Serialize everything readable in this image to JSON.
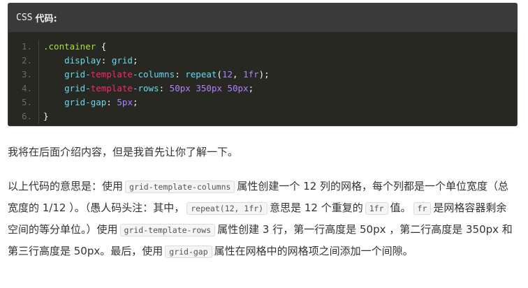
{
  "code_block": {
    "header_lang": "CSS",
    "header_label": "代码:",
    "lines": [
      {
        "num": "1.",
        "selector": ".container",
        "brace": " {"
      },
      {
        "num": "2.",
        "prop": "display",
        "value": "grid"
      },
      {
        "num": "3.",
        "prop_a": "grid-",
        "prop_b": "template",
        "prop_c": "-columns",
        "fn": "repeat",
        "arg1": "12",
        "arg2": "1fr"
      },
      {
        "num": "4.",
        "prop_a": "grid-",
        "prop_b": "template",
        "prop_c": "-rows",
        "v1": "50px",
        "v2": "350px",
        "v3": "50px"
      },
      {
        "num": "5.",
        "prop": "grid-gap",
        "value": "5px"
      },
      {
        "num": "6.",
        "brace": "}"
      }
    ]
  },
  "paragraph1": "我将在后面介绍内容，但是我首先让你了解一下。",
  "paragraph2": {
    "t1": "以上代码的意思是：使用",
    "c1": "grid-template-columns",
    "t2": "属性创建一个 12 列的网格，每个列都是一个单位宽度（总宽度的 1/12 ）。（愚人码头注：其中，",
    "c2": "repeat(12, 1fr)",
    "t3": "意思是 12 个重复的",
    "c3": "1fr",
    "t4": "值。",
    "c4": "fr",
    "t5": "是网格容器剩余空间的等分单位。）使用",
    "c5": "grid-template-rows",
    "t6": "属性创建 3 行，第一行高度是 50px ，第二行高度是 350px 和第三行高度是 50px。最后，使用",
    "c6": "grid-gap",
    "t7": "属性在网格中的网格项之间添加一个间隙。"
  }
}
